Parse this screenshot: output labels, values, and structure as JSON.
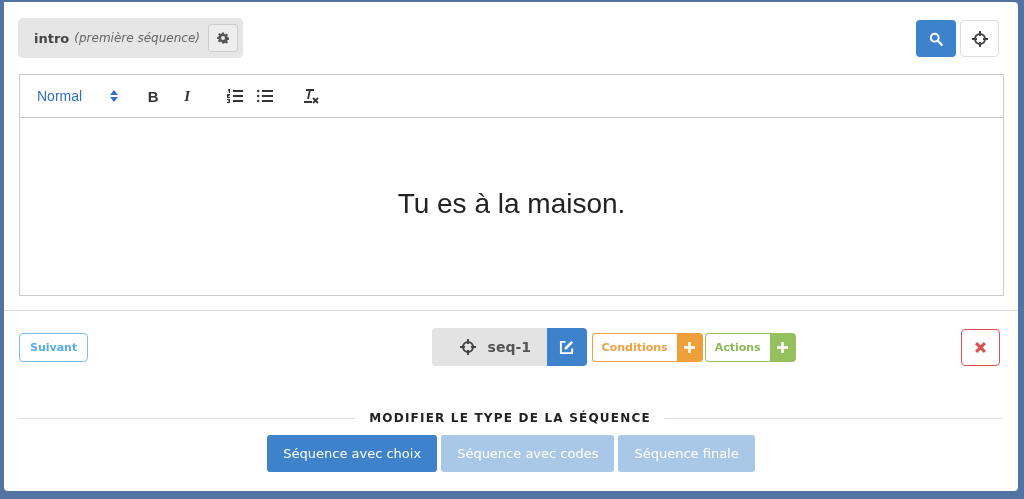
{
  "sequence_header": {
    "name": "intro",
    "note": "(première séquence)"
  },
  "editor": {
    "format": "Normal",
    "toolbar": [
      {
        "kind": "bold",
        "label": "B"
      },
      {
        "kind": "italic",
        "label": "I"
      },
      {
        "kind": "ordered-list"
      },
      {
        "kind": "bullet-list"
      },
      {
        "kind": "clear-format"
      }
    ],
    "content": "Tu es à la maison."
  },
  "footer": {
    "next_button": "Suivant",
    "sequence_id": "seq-1",
    "conditions_button": "Conditions",
    "actions_button": "Actions"
  },
  "type_section": {
    "title": "MODIFIER LE TYPE DE LA SÉQUENCE",
    "types": [
      {
        "label": "Séquence avec choix",
        "selected": true
      },
      {
        "label": "Séquence avec codes",
        "selected": false
      },
      {
        "label": "Séquence finale",
        "selected": false
      }
    ]
  }
}
